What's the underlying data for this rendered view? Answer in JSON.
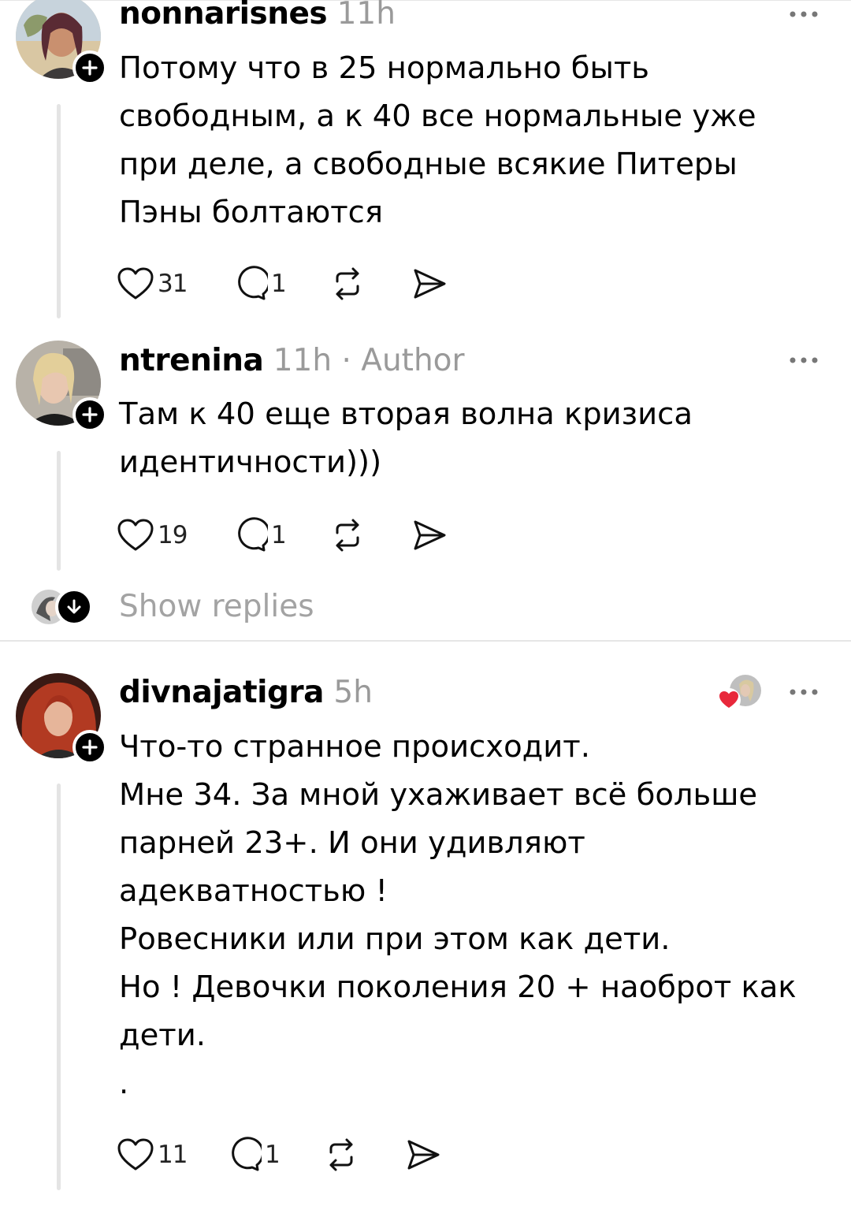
{
  "comments": [
    {
      "username": "nonnarisnes",
      "time": "11h",
      "author_tag": "",
      "body": "Потому что в 25 нормально быть\nсвободным, а к 40 все нормальные уже\nпри деле, а свободные всякие Питеры\nПэны болтаются",
      "likes": "31",
      "replies": "1"
    },
    {
      "username": "ntrenina",
      "time": "11h",
      "author_tag": "· Author",
      "body": "Там к 40 еще вторая волна кризиса\nидентичности)))",
      "likes": "19",
      "replies": "1"
    },
    {
      "username": "divnajatigra",
      "time": "5h",
      "author_tag": "",
      "body": "Что-то странное происходит.\nМне 34. За мной ухаживает всё больше\nпарней 23+. И они удивляют\nадекватностью !\nРовесники или при этом как дети.\nНо ! Девочки поколения 20 + наоброт как\nдети.\n.",
      "likes": "11",
      "replies": "1"
    }
  ],
  "show_replies_label": "Show replies",
  "icons": {
    "like": "heart-icon",
    "reply": "comment-bubble-icon",
    "repost": "repost-icon",
    "share": "send-icon",
    "more": "more-dots-icon",
    "follow": "plus-icon",
    "expand": "arrow-down-icon"
  },
  "colors": {
    "meta_text": "#9a9a9a",
    "liked_heart": "#e8283b",
    "thread_line": "#e4e4e4"
  }
}
